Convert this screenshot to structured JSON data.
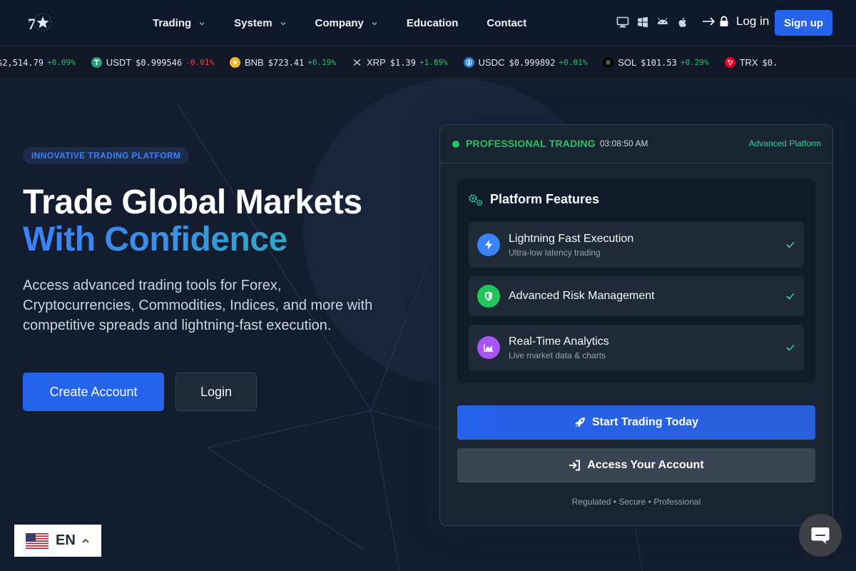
{
  "colors": {
    "accent": "#2563eb",
    "positive": "#22c55e",
    "negative": "#ef4444",
    "teal": "#34d399"
  },
  "nav": {
    "logo_icon": "seven-star-logo-icon",
    "links": [
      {
        "label": "Trading",
        "has_dropdown": true
      },
      {
        "label": "System",
        "has_dropdown": true
      },
      {
        "label": "Company",
        "has_dropdown": true
      },
      {
        "label": "Education",
        "has_dropdown": false
      },
      {
        "label": "Contact",
        "has_dropdown": false
      }
    ],
    "platform_icons": [
      "desktop-icon",
      "windows-icon",
      "android-icon",
      "apple-icon"
    ],
    "login_label": "Log in",
    "signup_label": "Sign up"
  },
  "ticker": [
    {
      "symbol": "",
      "price": "$2,514.79",
      "change": "+0.09%",
      "dir": "up",
      "icon_color": ""
    },
    {
      "symbol": "USDT",
      "price": "$0.999546",
      "change": "-0.01%",
      "dir": "down",
      "icon_color": "#26a17b"
    },
    {
      "symbol": "BNB",
      "price": "$723.41",
      "change": "+0.19%",
      "dir": "up",
      "icon_color": "#f3ba2f"
    },
    {
      "symbol": "XRP",
      "price": "$1.39",
      "change": "+1.89%",
      "dir": "up",
      "icon_color": "#334155"
    },
    {
      "symbol": "USDC",
      "price": "$0.999892",
      "change": "+0.01%",
      "dir": "up",
      "icon_color": "#2775ca"
    },
    {
      "symbol": "SOL",
      "price": "$101.53",
      "change": "+0.29%",
      "dir": "up",
      "icon_color": "#0b0f19"
    },
    {
      "symbol": "TRX",
      "price": "$0.",
      "change": "",
      "dir": "up",
      "icon_color": "#eb0029"
    }
  ],
  "hero": {
    "badge": "INNOVATIVE TRADING PLATFORM",
    "title_line1": "Trade Global Markets",
    "title_line2": "With Confidence",
    "description": "Access advanced trading tools for Forex, Cryptocurrencies, Commodities, Indices, and more with competitive spreads and lightning-fast execution.",
    "cta_primary": "Create Account",
    "cta_secondary": "Login"
  },
  "card": {
    "status": "PROFESSIONAL TRADING",
    "time": "03:08:50 AM",
    "tag": "Advanced Platform",
    "features_title": "Platform Features",
    "features": [
      {
        "title": "Lightning Fast Execution",
        "subtitle": "Ultra-low latency trading",
        "icon": "lightning-icon",
        "color": "#3b82f6"
      },
      {
        "title": "Advanced Risk Management",
        "subtitle": "",
        "icon": "shield-icon",
        "color": "#22c55e"
      },
      {
        "title": "Real-Time Analytics",
        "subtitle": "Live market data & charts",
        "icon": "chart-icon",
        "color": "#a855f7"
      }
    ],
    "start_label": "Start Trading Today",
    "access_label": "Access Your Account",
    "footer": "Regulated • Secure • Professional"
  },
  "language": {
    "code": "EN",
    "flag_icon": "us-flag-icon"
  },
  "chat_icon": "chat-bubble-icon"
}
